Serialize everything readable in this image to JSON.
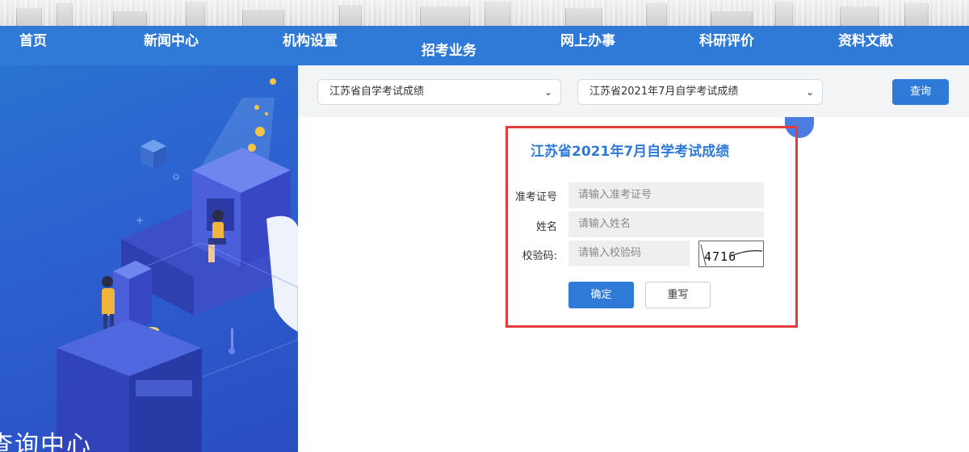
{
  "nav": {
    "items": [
      {
        "label": "首页"
      },
      {
        "label": "新闻中心"
      },
      {
        "label": "机构设置"
      },
      {
        "label": "招考业务"
      },
      {
        "label": "网上办事"
      },
      {
        "label": "科研评价"
      },
      {
        "label": "资料文献"
      }
    ]
  },
  "sidebar": {
    "caption": "查询中心"
  },
  "query": {
    "category_select": "江苏省自学考试成绩",
    "exam_select": "江苏省2021年7月自学考试成绩",
    "search_button": "查询"
  },
  "form": {
    "title": "江苏省2021年7月自学考试成绩",
    "fields": [
      {
        "label": "准考证号",
        "placeholder": "请输入准考证号"
      },
      {
        "label": "姓名",
        "placeholder": "请输入姓名"
      },
      {
        "label": "校验码:",
        "placeholder": "请输入校验码"
      }
    ],
    "captcha_text": "4716",
    "confirm_button": "确定",
    "reset_button": "重写"
  },
  "colors": {
    "accent": "#2f7ad7",
    "highlight_border": "#e53b3b",
    "panel_blue": "#2a5fcc"
  }
}
